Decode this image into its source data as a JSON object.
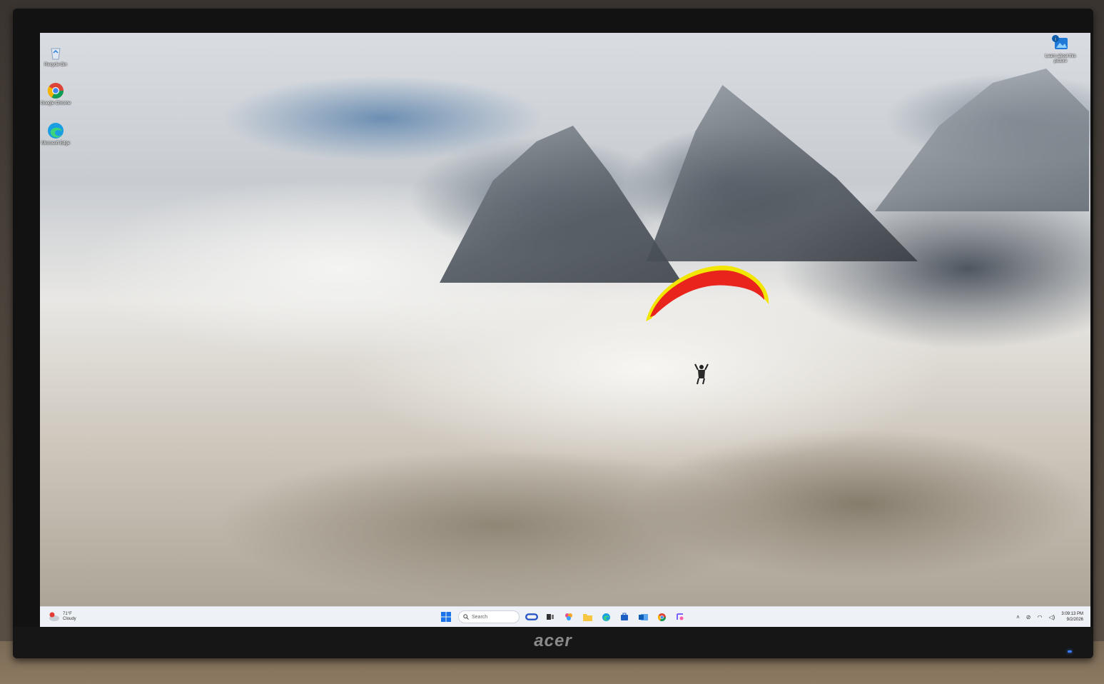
{
  "desktop": {
    "icons": [
      {
        "icon": "recycle-bin-icon",
        "label": "Recycle Bin"
      },
      {
        "icon": "chrome-icon",
        "label": "Google Chrome"
      },
      {
        "icon": "edge-icon",
        "label": "Microsoft Edge"
      },
      {
        "icon": "learn-about-picture-icon",
        "label": "Learn about this picture"
      }
    ]
  },
  "taskbar": {
    "weather": {
      "temperature": "71°F",
      "condition": "Cloudy",
      "badge": "1"
    },
    "search": {
      "placeholder": "Search"
    },
    "pinned": [
      "copilot-icon",
      "task-view-icon",
      "start-icon",
      "file-explorer-icon",
      "edge-icon",
      "store-icon",
      "outlook-icon",
      "chrome-icon",
      "snipping-tool-icon"
    ],
    "tray": {
      "time": "3:09:13 PM",
      "date": "9/2/2026"
    }
  },
  "monitor": {
    "brand": "acer"
  },
  "colors": {
    "taskbar_bg": "#eef1f5",
    "glider_red": "#e8241c",
    "glider_yellow": "#f2e600",
    "start_blue": "#1a73e8"
  }
}
